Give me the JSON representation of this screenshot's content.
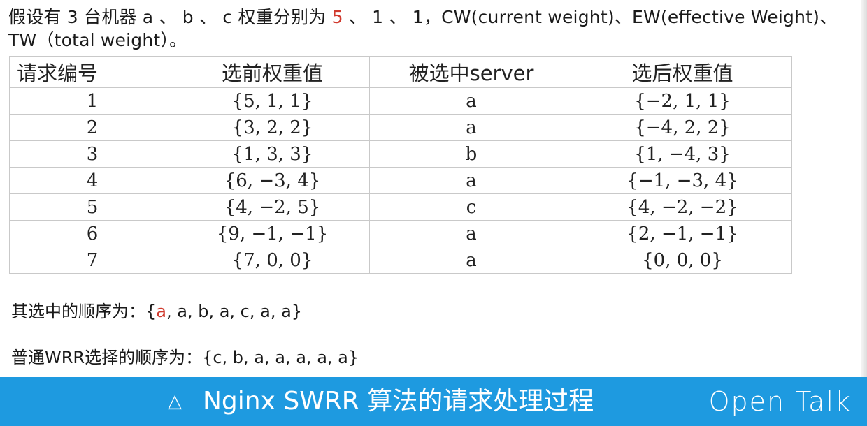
{
  "intro": {
    "part1": "假设有 3 台机器 a 、 b 、 c 权重分别为 ",
    "highlight": "5",
    "part2": " 、 1 、 1，CW(current weight)、EW(effective Weight)、TW（total weight）。"
  },
  "table": {
    "headers": [
      "请求编号",
      "选前权重值",
      "被选中server",
      "选后权重值"
    ],
    "rows": [
      [
        "1",
        "{5, 1, 1}",
        "a",
        "{−2, 1, 1}"
      ],
      [
        "2",
        "{3, 2, 2}",
        "a",
        "{−4, 2, 2}"
      ],
      [
        "3",
        "{1, 3, 3}",
        "b",
        "{1, −4, 3}"
      ],
      [
        "4",
        "{6, −3, 4}",
        "a",
        "{−1, −3, 4}"
      ],
      [
        "5",
        "{4, −2, 5}",
        "c",
        "{4, −2, −2}"
      ],
      [
        "6",
        "{9, −1, −1}",
        "a",
        "{2, −1, −1}"
      ],
      [
        "7",
        "{7, 0, 0}",
        "a",
        "{0, 0, 0}"
      ]
    ]
  },
  "summary": {
    "swrr_prefix": "其选中的顺序为：{",
    "swrr_highlight": "a",
    "swrr_rest": ", a, b, a, c, a, a}",
    "wrr_text": "普通WRR选择的顺序为：{c, b, a, a, a, a, a}"
  },
  "banner": {
    "icon": "triangle-icon",
    "icon_glyph": "△",
    "title": "Nginx SWRR 算法的请求处理过程",
    "brand": "Open Talk"
  },
  "colors": {
    "accent_red": "#d03a2e",
    "banner_blue": "#1e9ae0"
  }
}
